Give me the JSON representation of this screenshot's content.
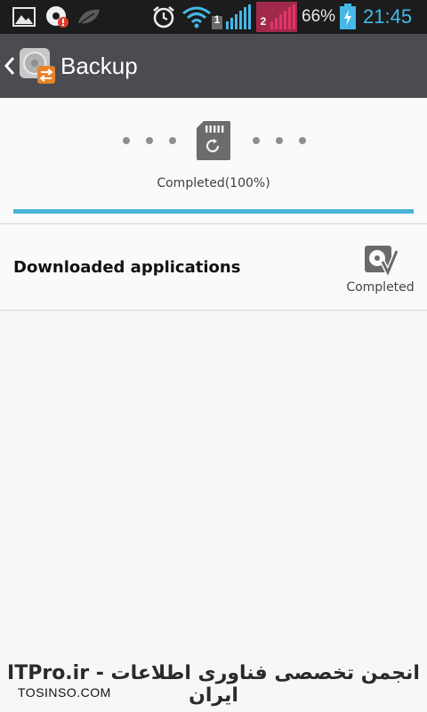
{
  "status_bar": {
    "sim1_label": "1",
    "sim2_label": "2",
    "battery_percent": "66%",
    "time": "21:45",
    "icons": [
      "gallery-icon",
      "music-notification-icon",
      "leaf-icon",
      "alarm-icon",
      "wifi-icon",
      "signal-sim1-icon",
      "signal-sim2-icon",
      "battery-charging-icon"
    ]
  },
  "action_bar": {
    "title": "Backup",
    "back_icon": "chevron-left-icon",
    "app_icon": "backup-app-icon"
  },
  "progress": {
    "status_text": "Completed(100%)",
    "percent": 100,
    "accent_color": "#4db3d6"
  },
  "items": [
    {
      "label": "Downloaded applications",
      "status": "Completed",
      "icon": "drive-check-icon"
    }
  ],
  "watermark": {
    "line1": "ITPro.ir - انجمن تخصصی فناوری اطلاعات ایران",
    "line2": "TOSINSO.COM"
  }
}
